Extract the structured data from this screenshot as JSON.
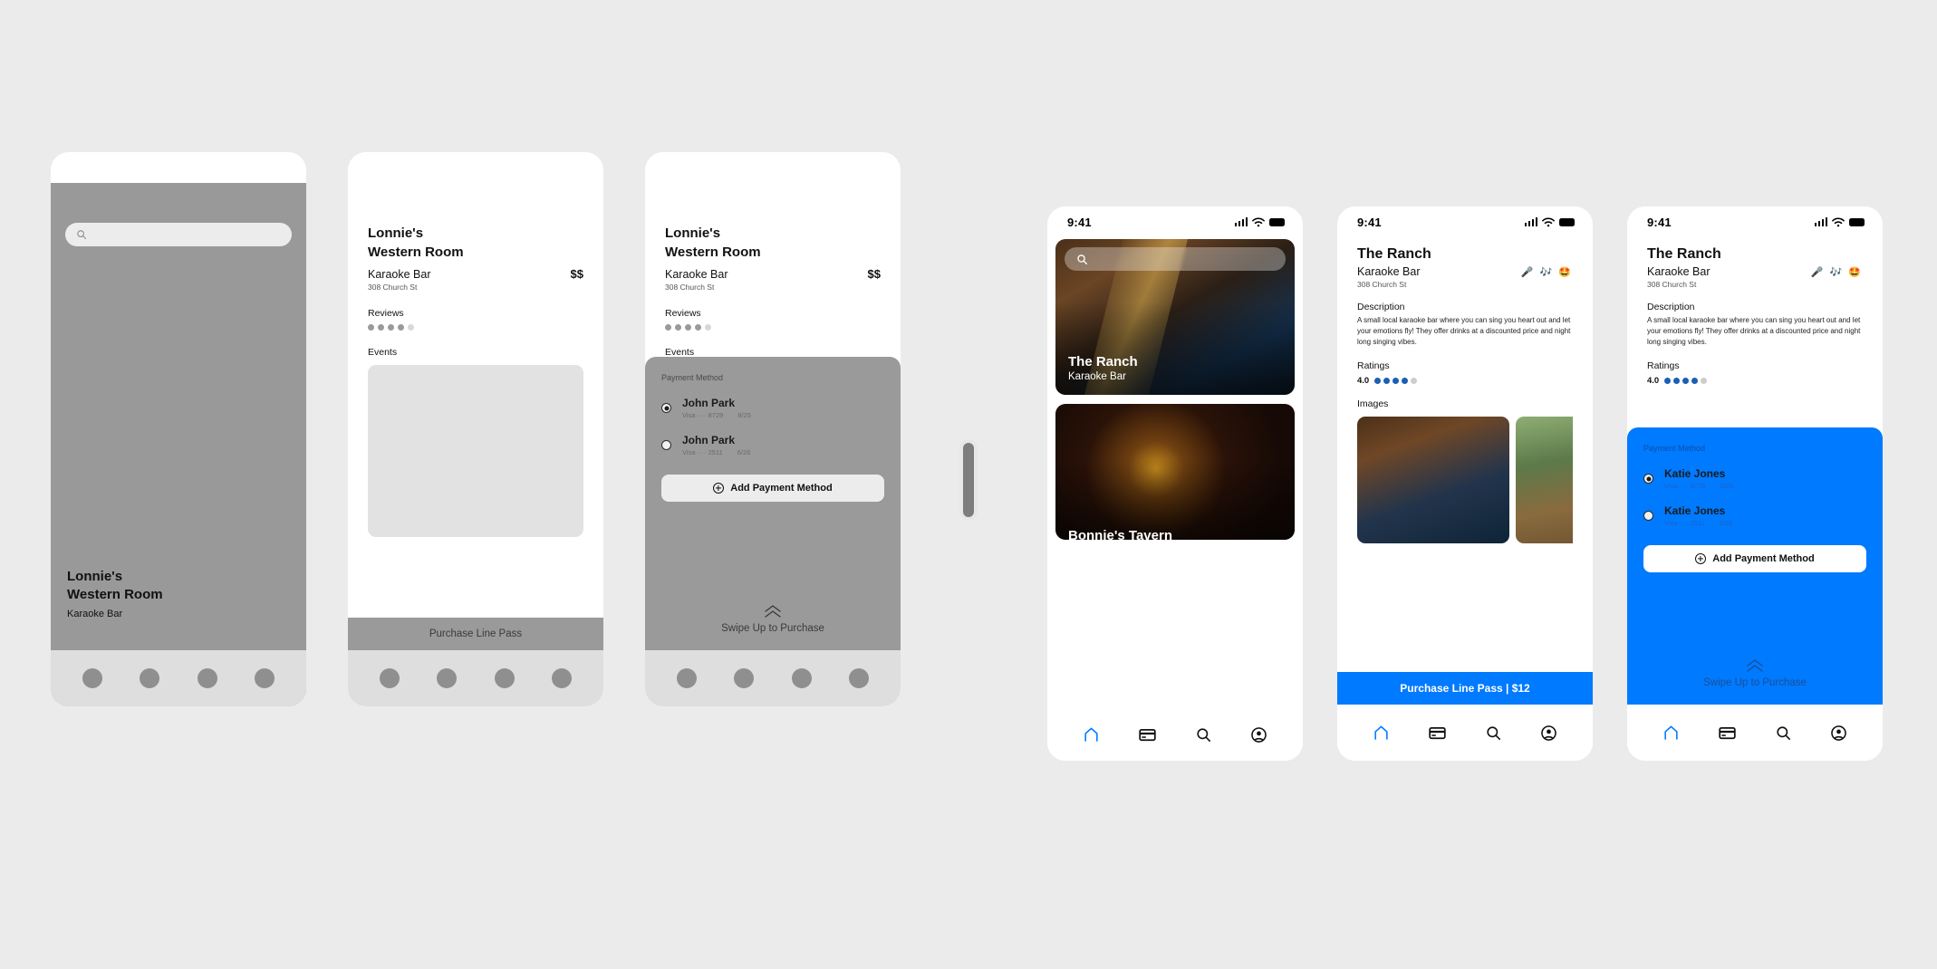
{
  "statusbar": {
    "time": "9:41",
    "signal_icon": "cellular-bars-icon",
    "wifi_icon": "wifi-icon",
    "battery_icon": "battery-icon"
  },
  "venue_wire": {
    "name_line1": "Lonnie's",
    "name_line2": "Western Room",
    "category": "Karaoke Bar",
    "price": "$$",
    "address": "308 Church St",
    "reviews_label": "Reviews",
    "events_label": "Events",
    "cta": "Purchase Line Pass",
    "reviews_filled": 4,
    "reviews_total": 5
  },
  "payment_wire": {
    "label": "Payment Method",
    "methods": [
      {
        "name": "John Park",
        "card": "Visa ···· 8729",
        "exp": "8/25",
        "selected": true
      },
      {
        "name": "John Park",
        "card": "Visa ···· 2511",
        "exp": "6/26",
        "selected": false
      }
    ],
    "add_label": "Add Payment Method",
    "swipe_label": "Swipe Up to Purchase"
  },
  "feed": {
    "search_placeholder": "",
    "cards": [
      {
        "title": "The Ranch",
        "subtitle": "Karaoke Bar"
      },
      {
        "title": "Bonnie's Tavern",
        "subtitle": ""
      }
    ]
  },
  "venue_detail": {
    "title": "The Ranch",
    "category": "Karaoke Bar",
    "emoji": "🎤 🎶 🤩",
    "address": "308 Church St",
    "description_label": "Description",
    "description": "A small local karaoke bar where you can sing you heart out and let your emotions fly! They offer drinks at a discounted price and night long singing vibes.",
    "ratings_label": "Ratings",
    "rating_value": "4.0",
    "rating_filled": 4,
    "rating_total": 5,
    "images_label": "Images",
    "cta": "Purchase Line Pass | $12"
  },
  "payment_live": {
    "label": "Payment Method",
    "methods": [
      {
        "name": "Katie Jones",
        "card": "Visa ···· 8729",
        "exp": "8/25",
        "selected": true
      },
      {
        "name": "Katie Jones",
        "card": "Visa ···· 2511",
        "exp": "6/26",
        "selected": false
      }
    ],
    "add_label": "Add Payment Method",
    "swipe_label": "Swipe Up to Purchase"
  },
  "tabbar": {
    "items": [
      {
        "icon": "home-icon",
        "active": true
      },
      {
        "icon": "card-icon",
        "active": false
      },
      {
        "icon": "search-icon",
        "active": false
      },
      {
        "icon": "profile-icon",
        "active": false
      }
    ]
  },
  "colors": {
    "accent": "#007aff",
    "wireframe_grey": "#999999",
    "canvas": "#ebebeb"
  }
}
